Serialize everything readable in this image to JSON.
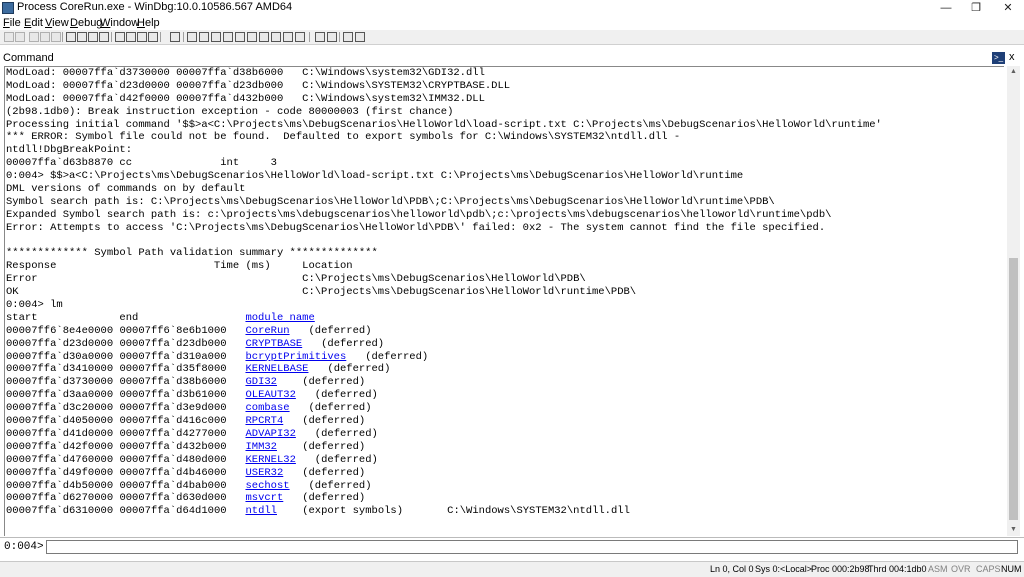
{
  "window": {
    "title": "Process CoreRun.exe - WinDbg:10.0.10586.567 AMD64",
    "min_glyph": "—",
    "max_glyph": "❐",
    "close_glyph": "✕"
  },
  "menu": [
    "File",
    "Edit",
    "View",
    "Debug",
    "Window",
    "Help"
  ],
  "command_window": {
    "label": "Command",
    "close_glyph": "x"
  },
  "output_lines": [
    "ModLoad: 00007ffa`d3730000 00007ffa`d38b6000   C:\\Windows\\system32\\GDI32.dll",
    "ModLoad: 00007ffa`d23d0000 00007ffa`d23db000   C:\\Windows\\SYSTEM32\\CRYPTBASE.DLL",
    "ModLoad: 00007ffa`d42f0000 00007ffa`d432b000   C:\\Windows\\system32\\IMM32.DLL",
    "(2b98.1db0): Break instruction exception - code 80000003 (first chance)",
    "Processing initial command '$$>a<C:\\Projects\\ms\\DebugScenarios\\HelloWorld\\load-script.txt C:\\Projects\\ms\\DebugScenarios\\HelloWorld\\runtime'",
    "*** ERROR: Symbol file could not be found.  Defaulted to export symbols for C:\\Windows\\SYSTEM32\\ntdll.dll -",
    "ntdll!DbgBreakPoint:",
    "00007ffa`d63b8870 cc              int     3",
    "0:004> $$>a<C:\\Projects\\ms\\DebugScenarios\\HelloWorld\\load-script.txt C:\\Projects\\ms\\DebugScenarios\\HelloWorld\\runtime",
    "DML versions of commands on by default",
    "Symbol search path is: C:\\Projects\\ms\\DebugScenarios\\HelloWorld\\PDB\\;C:\\Projects\\ms\\DebugScenarios\\HelloWorld\\runtime\\PDB\\",
    "Expanded Symbol search path is: c:\\projects\\ms\\debugscenarios\\helloworld\\pdb\\;c:\\projects\\ms\\debugscenarios\\helloworld\\runtime\\pdb\\",
    "Error: Attempts to access 'C:\\Projects\\ms\\DebugScenarios\\HelloWorld\\PDB\\' failed: 0x2 - The system cannot find the file specified.",
    "",
    "************* Symbol Path validation summary **************",
    "Response                         Time (ms)     Location",
    "Error                                          C:\\Projects\\ms\\DebugScenarios\\HelloWorld\\PDB\\",
    "OK                                             C:\\Projects\\ms\\DebugScenarios\\HelloWorld\\runtime\\PDB\\",
    "0:004> lm"
  ],
  "module_table": {
    "header_prefix": "start             end                 ",
    "header_link": "module name",
    "rows": [
      {
        "start": "00007ff6`8e4e0000",
        "end": "00007ff6`8e6b1000",
        "name": "CoreRun",
        "status": "(deferred)",
        "path": ""
      },
      {
        "start": "00007ffa`d23d0000",
        "end": "00007ffa`d23db000",
        "name": "CRYPTBASE",
        "status": "(deferred)",
        "path": ""
      },
      {
        "start": "00007ffa`d30a0000",
        "end": "00007ffa`d310a000",
        "name": "bcryptPrimitives",
        "status": "(deferred)",
        "path": ""
      },
      {
        "start": "00007ffa`d3410000",
        "end": "00007ffa`d35f8000",
        "name": "KERNELBASE",
        "status": "(deferred)",
        "path": ""
      },
      {
        "start": "00007ffa`d3730000",
        "end": "00007ffa`d38b6000",
        "name": "GDI32",
        "status": "(deferred)",
        "path": ""
      },
      {
        "start": "00007ffa`d3aa0000",
        "end": "00007ffa`d3b61000",
        "name": "OLEAUT32",
        "status": "(deferred)",
        "path": ""
      },
      {
        "start": "00007ffa`d3c20000",
        "end": "00007ffa`d3e9d000",
        "name": "combase",
        "status": "(deferred)",
        "path": ""
      },
      {
        "start": "00007ffa`d4050000",
        "end": "00007ffa`d416c000",
        "name": "RPCRT4",
        "status": "(deferred)",
        "path": ""
      },
      {
        "start": "00007ffa`d41d0000",
        "end": "00007ffa`d4277000",
        "name": "ADVAPI32",
        "status": "(deferred)",
        "path": ""
      },
      {
        "start": "00007ffa`d42f0000",
        "end": "00007ffa`d432b000",
        "name": "IMM32",
        "status": "(deferred)",
        "path": ""
      },
      {
        "start": "00007ffa`d4760000",
        "end": "00007ffa`d480d000",
        "name": "KERNEL32",
        "status": "(deferred)",
        "path": ""
      },
      {
        "start": "00007ffa`d49f0000",
        "end": "00007ffa`d4b46000",
        "name": "USER32",
        "status": "(deferred)",
        "path": ""
      },
      {
        "start": "00007ffa`d4b50000",
        "end": "00007ffa`d4bab000",
        "name": "sechost",
        "status": "(deferred)",
        "path": ""
      },
      {
        "start": "00007ffa`d6270000",
        "end": "00007ffa`d630d000",
        "name": "msvcrt",
        "status": "(deferred)",
        "path": ""
      },
      {
        "start": "00007ffa`d6310000",
        "end": "00007ffa`d64d1000",
        "name": "ntdll",
        "status": "(export symbols)",
        "path": "C:\\Windows\\SYSTEM32\\ntdll.dll"
      }
    ]
  },
  "input": {
    "prompt": "0:004>",
    "value": ""
  },
  "status": {
    "ln_col": "Ln 0, Col 0",
    "sys": "Sys 0:<Local>",
    "proc": "Proc 000:2b98",
    "thrd": "Thrd 004:1db0",
    "asm": "ASM",
    "ovr": "OVR",
    "caps": "CAPS",
    "num": "NUM"
  },
  "colors": {
    "link": "#0000ee",
    "pin_bg": "#1f3f77"
  }
}
